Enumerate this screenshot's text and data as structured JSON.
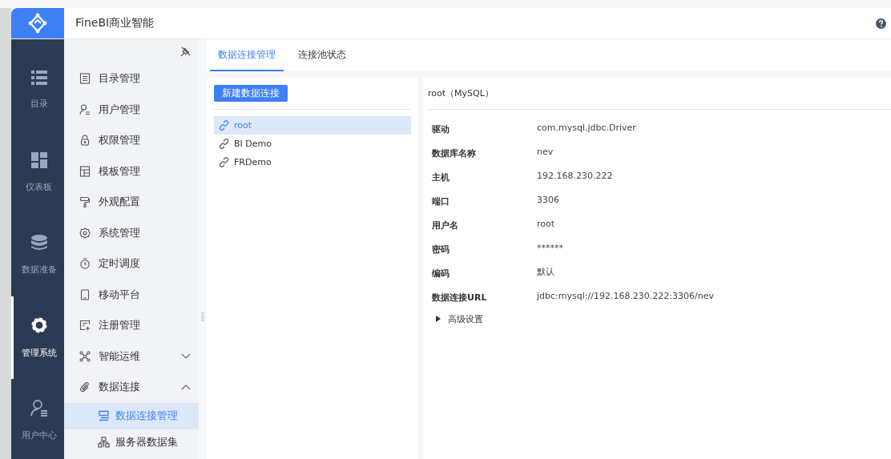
{
  "header": {
    "title": "FineBI商业智能"
  },
  "nav": [
    {
      "label": "目录",
      "selected": false
    },
    {
      "label": "仪表板",
      "selected": false
    },
    {
      "label": "数据准备",
      "selected": false
    },
    {
      "label": "管理系统",
      "selected": true
    },
    {
      "label": "用户中心",
      "selected": false
    }
  ],
  "menu": [
    {
      "label": "目录管理",
      "selected": false
    },
    {
      "label": "用户管理",
      "selected": false
    },
    {
      "label": "权限管理",
      "selected": false
    },
    {
      "label": "模板管理",
      "selected": false
    },
    {
      "label": "外观配置",
      "selected": false
    },
    {
      "label": "系统管理",
      "selected": false
    },
    {
      "label": "定时调度",
      "selected": false
    },
    {
      "label": "移动平台",
      "selected": false
    },
    {
      "label": "注册管理",
      "selected": false
    },
    {
      "label": "智能运维",
      "selected": false,
      "expanded": false
    },
    {
      "label": "数据连接",
      "selected": false,
      "expanded": true,
      "children": [
        {
          "label": "数据连接管理",
          "selected": true
        },
        {
          "label": "服务器数据集",
          "selected": false
        }
      ]
    }
  ],
  "tabs": [
    {
      "label": "数据连接管理",
      "selected": true
    },
    {
      "label": "连接池状态",
      "selected": false
    }
  ],
  "new_button": "新建数据连接",
  "connections": [
    {
      "label": "root",
      "selected": true
    },
    {
      "label": "BI Demo",
      "selected": false
    },
    {
      "label": "FRDemo",
      "selected": false
    }
  ],
  "detail": {
    "title": "root（MySQL）",
    "fields": [
      {
        "label": "驱动",
        "value": "com.mysql.jdbc.Driver"
      },
      {
        "label": "数据库名称",
        "value": "nev"
      },
      {
        "label": "主机",
        "value": "192.168.230.222"
      },
      {
        "label": "端口",
        "value": "3306"
      },
      {
        "label": "用户名",
        "value": "root"
      },
      {
        "label": "密码",
        "value": "******"
      },
      {
        "label": "编码",
        "value": "默认"
      },
      {
        "label": "数据连接URL",
        "value": "jdbc:mysql://192.168.230.222:3306/nev"
      }
    ],
    "advanced": {
      "label": "高级设置",
      "expanded": false
    }
  }
}
